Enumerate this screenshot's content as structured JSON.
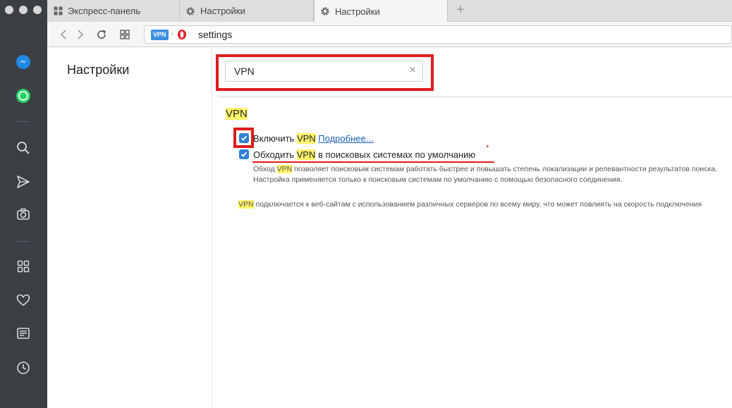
{
  "tabs": [
    {
      "label": "Экспресс-панель",
      "icon": "grid-icon"
    },
    {
      "label": "Настройки",
      "icon": "gear-icon"
    },
    {
      "label": "Настройки",
      "icon": "gear-icon"
    }
  ],
  "address": {
    "vpn_badge": "VPN",
    "url": "settings"
  },
  "settings_sidebar": {
    "title": "Настройки"
  },
  "search": {
    "value": "VPN"
  },
  "vpn_section": {
    "title": "VPN",
    "option1": {
      "label_pre": "Включить ",
      "label_hl": "VPN",
      "learn_more": "Подробнее...",
      "checked": true
    },
    "option2": {
      "label_pre": "Обходить ",
      "label_hl": "VPN",
      "label_post": " в поисковых системах по умолчанию",
      "asterisk": "*",
      "checked": true,
      "desc_pre": "Обход ",
      "desc_hl": "VPN",
      "desc_post": " позволяет поисковым системам работать быстрее и повышать степень локализации и релевантности результатов поиска. Настройка применяется только к поисковым системам по умолчанию с помощью безопасного соединения."
    },
    "note_hl": "VPN",
    "note_post": " подключается к веб-сайтам с использованием различных серверов по всему миру, что может повлиять на скорость подключения"
  },
  "colors": {
    "sidebar_bg": "#3b3f44",
    "accent_blue": "#2f7fd8",
    "highlight_red": "#e01c1c",
    "search_highlight": "#fff36a",
    "messenger_blue": "#1e88e5",
    "whatsapp_green": "#25d366"
  },
  "sidebar_icons": [
    "messenger-icon",
    "whatsapp-icon",
    "search-icon",
    "send-icon",
    "camera-icon",
    "grid-icon",
    "heart-icon",
    "news-icon",
    "clock-icon"
  ]
}
